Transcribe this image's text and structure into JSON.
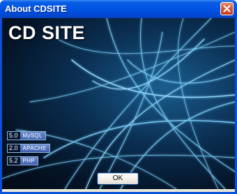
{
  "window": {
    "title": "About CDSITE"
  },
  "banner": {
    "logo_text": "CD SITE"
  },
  "versions": [
    {
      "number": "5.0",
      "name": "MySQL"
    },
    {
      "number": "2.0",
      "name": "APACHE"
    },
    {
      "number": "5.2",
      "name": "PHP"
    }
  ],
  "buttons": {
    "ok_label": "OK"
  },
  "icons": {
    "close": "close-icon"
  },
  "colors": {
    "titlebar": "#0055e5",
    "close_button": "#d55a3a",
    "artwork_glow": "#7fd4ff"
  }
}
